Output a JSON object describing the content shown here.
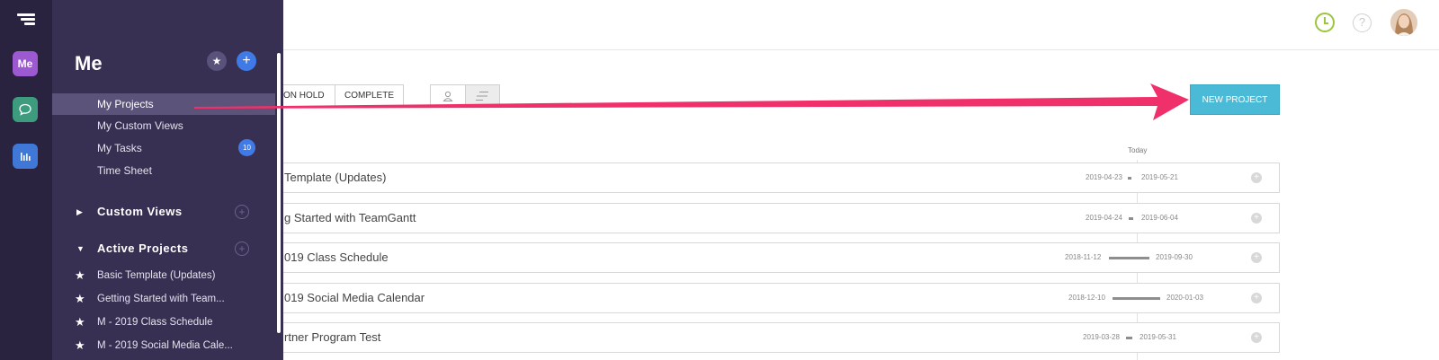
{
  "header": {
    "help_label": "?"
  },
  "filters": {
    "status_buttons": [
      "ON HOLD",
      "COMPLETE"
    ]
  },
  "new_project_label": "NEW PROJECT",
  "timeline": {
    "today_label": "Today"
  },
  "projects": [
    {
      "name": "Template (Updates)",
      "start": "2019-04-23",
      "end": "2019-05-21"
    },
    {
      "name": "g Started with TeamGantt",
      "start": "2019-04-24",
      "end": "2019-06-04"
    },
    {
      "name": "019 Class Schedule",
      "start": "2018-11-12",
      "end": "2019-09-30"
    },
    {
      "name": "019 Social Media Calendar",
      "start": "2018-12-10",
      "end": "2020-01-03"
    },
    {
      "name": "rtner Program Test",
      "start": "2019-03-28",
      "end": "2019-05-31"
    }
  ],
  "rail": {
    "me_label": "Me"
  },
  "sidebar": {
    "title": "Me",
    "nav": [
      {
        "label": "My Projects",
        "active": true
      },
      {
        "label": "My Custom Views"
      },
      {
        "label": "My Tasks",
        "badge": "10"
      },
      {
        "label": "Time Sheet"
      }
    ],
    "custom_views_label": "Custom Views",
    "active_projects_label": "Active Projects",
    "active_projects": [
      "Basic Template (Updates)",
      "Getting Started with Team...",
      "M - 2019 Class Schedule",
      "M - 2019 Social Media Cale..."
    ]
  },
  "colors": {
    "rail_bg": "#2a2340",
    "sidebar_bg": "#383052",
    "accent_blue": "#3f7ae6",
    "new_project_bg": "#4bbad6",
    "arrow": "#f0306a"
  }
}
